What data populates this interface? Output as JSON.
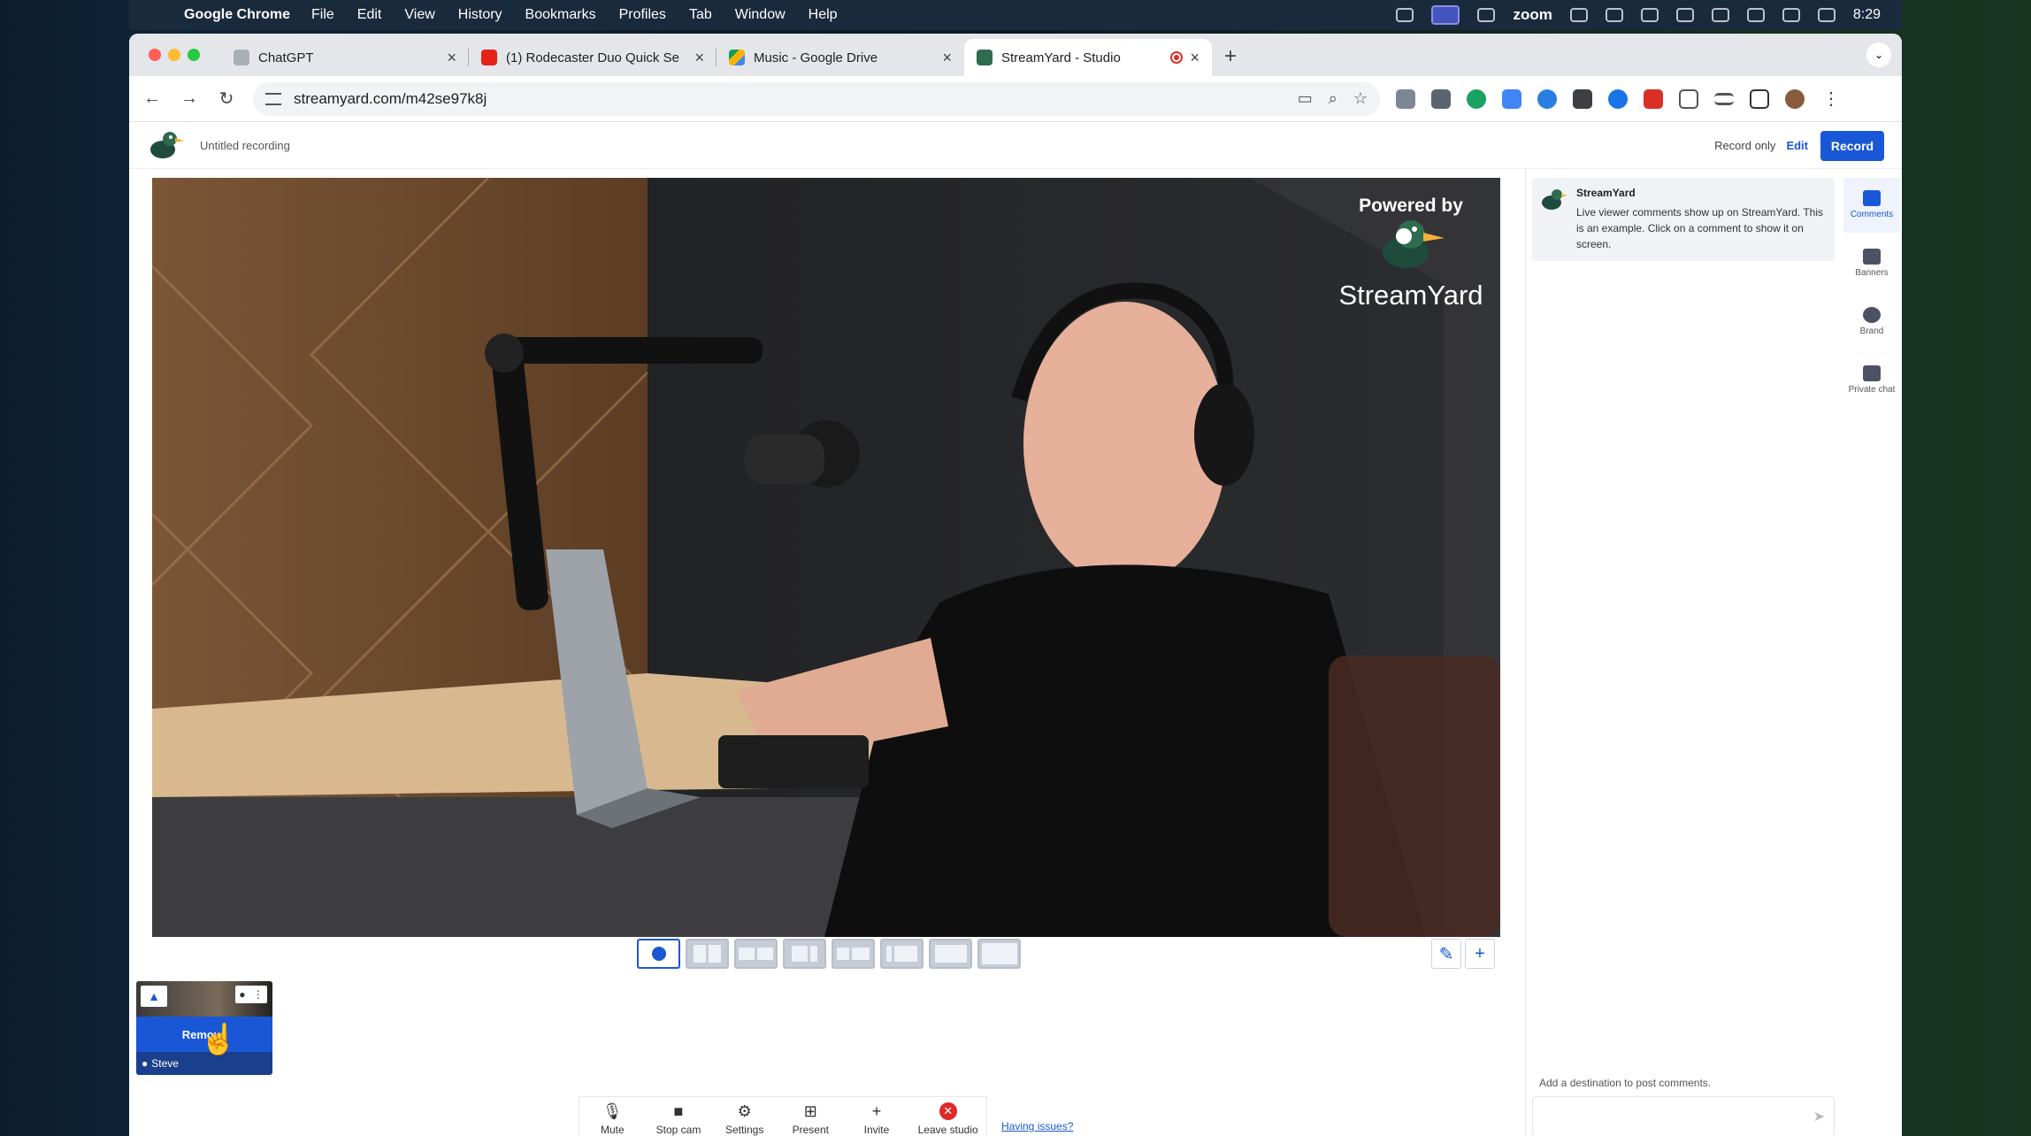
{
  "menubar": {
    "app": "Google Chrome",
    "items": [
      "File",
      "Edit",
      "View",
      "History",
      "Bookmarks",
      "Profiles",
      "Tab",
      "Window",
      "Help"
    ],
    "zoom_label": "zoom",
    "clock": "8:29"
  },
  "tabs": [
    {
      "title": "ChatGPT",
      "color": "#a7b0b7"
    },
    {
      "title": "(1) Rodecaster Duo Quick Se",
      "color": "#e62117"
    },
    {
      "title": "Music - Google Drive",
      "color": "#f4b400"
    },
    {
      "title": "StreamYard - Studio",
      "color": "#2e6b4f"
    }
  ],
  "address": {
    "url": "streamyard.com/m42se97k8j"
  },
  "app": {
    "recording_title": "Untitled recording",
    "record_only": "Record only",
    "edit": "Edit",
    "record": "Record",
    "powered_by": "Powered by",
    "brand": "StreamYard",
    "pencil_icon": "pencil-icon",
    "add_icon": "plus-icon"
  },
  "participant": {
    "remove_label": "Remove",
    "name": "Steve"
  },
  "controls": [
    {
      "label": "Mute",
      "icon": "🎙"
    },
    {
      "label": "Stop cam",
      "icon": "■"
    },
    {
      "label": "Settings",
      "icon": "⚙"
    },
    {
      "label": "Present",
      "icon": "⊞"
    },
    {
      "label": "Invite",
      "icon": "+"
    },
    {
      "label": "Leave studio",
      "icon": "✕"
    }
  ],
  "having_issues": "Having issues?",
  "comments": {
    "author": "StreamYard",
    "message": "Live viewer comments show up on StreamYard. This is an example. Click on a comment to show it on screen.",
    "destination_hint": "Add a destination to post comments."
  },
  "rightnav": [
    {
      "label": "Comments"
    },
    {
      "label": "Banners"
    },
    {
      "label": "Brand"
    },
    {
      "label": "Private chat"
    }
  ],
  "colors": {
    "accent": "#1a57d6",
    "leave": "#e02828"
  }
}
